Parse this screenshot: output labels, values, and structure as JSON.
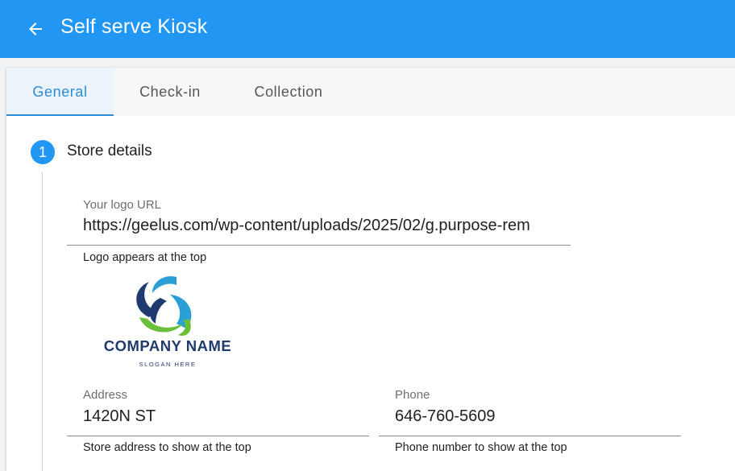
{
  "appbar": {
    "title": "Self serve Kiosk",
    "back_icon": "arrow-left-icon",
    "color": "#2196f3"
  },
  "tabs": [
    {
      "label": "General",
      "active": true
    },
    {
      "label": "Check-in",
      "active": false
    },
    {
      "label": "Collection",
      "active": false
    }
  ],
  "step": {
    "number": "1",
    "title": "Store details"
  },
  "logo_url": {
    "label": "Your logo URL",
    "value": "https://geelus.com/wp-content/uploads/2025/02/g.purpose-rem",
    "helper": "Logo appears at the top"
  },
  "logo_preview": {
    "company": "COMPANY NAME",
    "slogan": "SLOGAN HERE"
  },
  "address": {
    "label": "Address",
    "value": "1420N ST",
    "helper": "Store address to show at the top"
  },
  "phone": {
    "label": "Phone",
    "value": "646-760-5609",
    "helper": "Phone number to show at the top"
  },
  "colors": {
    "accent": "#2196f3",
    "tab_active": "#2b8bd6",
    "logo_navy": "#1f3a6e",
    "logo_blue": "#2a9fd6",
    "logo_green": "#6abf3a"
  }
}
